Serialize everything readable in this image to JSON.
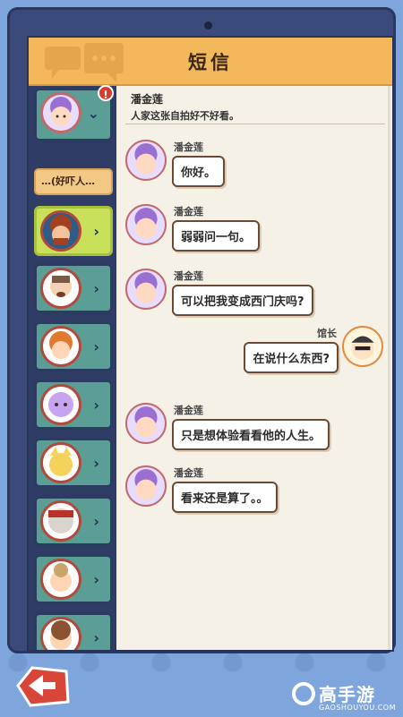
{
  "header": {
    "title": "短信"
  },
  "chat": {
    "contact_name": "潘金莲",
    "contact_last_message": "人家这张自拍好不好看。",
    "messages": [
      {
        "side": "left",
        "sender": "潘金莲",
        "text": "你好。"
      },
      {
        "side": "left",
        "sender": "潘金莲",
        "text": "弱弱问一句。"
      },
      {
        "side": "left",
        "sender": "潘金莲",
        "text": "可以把我变成西门庆吗?"
      },
      {
        "side": "right",
        "sender": "馆长",
        "text": "在说什么东西?"
      },
      {
        "side": "left",
        "sender": "潘金莲",
        "text": "只是想体验看看他的人生。"
      },
      {
        "side": "left",
        "sender": "潘金莲",
        "text": "看来还是算了。。"
      }
    ]
  },
  "sidebar": {
    "alert_badge": "!",
    "preview_text": "…(好吓人…",
    "chevron_expanded": "⌄",
    "chevron": "›"
  },
  "brand": {
    "name": "高手游",
    "domain": "GAOSHOUYOU.COM"
  },
  "colors": {
    "header": "#f3b85b",
    "card": "#5b9e96",
    "card_active": "#c8e05a",
    "bubble_border": "#6b4a35"
  }
}
